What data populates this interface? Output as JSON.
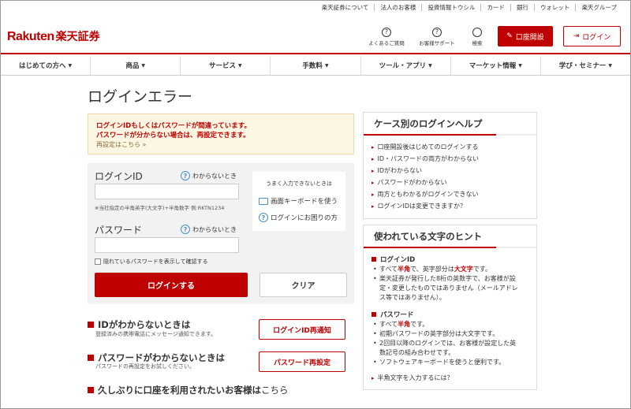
{
  "util_links": [
    "楽天証券について",
    "法人のお客様",
    "投資情報トウシル",
    "カード",
    "銀行",
    "ウォレット",
    "楽天グループ"
  ],
  "header": {
    "logo_text": "Rakuten",
    "logo_jp": "楽天証券",
    "faq_label": "よくあるご質問",
    "support_label": "お客様サポート",
    "search_label": "検索",
    "open_account_label": "口座開設",
    "login_label": "ログイン"
  },
  "nav": [
    "はじめての方へ",
    "商品",
    "サービス",
    "手数料",
    "ツール・アプリ",
    "マーケット情報",
    "学び・セミナー"
  ],
  "page_title": "ログインエラー",
  "error": {
    "line1": "ログインIDもしくはパスワードが間違っています。",
    "line2": "パスワードが分からない場合は、再設定できます。",
    "link": "再設定はこちら »"
  },
  "form": {
    "id_label": "ログインID",
    "id_help": "わからないとき",
    "id_hint": "※当社指定の半角英字(大文字)+半角数字 例:RKTN1234",
    "pw_label": "パスワード",
    "pw_help": "わからないとき",
    "side_title": "うまく入力できないときは",
    "side_kbd": "画面キーボードを使う",
    "side_help": "ログインにお困りの方",
    "show_pw": "隠れているパスワードを表示して確認する",
    "login_btn": "ログインする",
    "clear_btn": "クリア"
  },
  "help_rows": {
    "id_title": "IDがわからないとき は",
    "id_title_text": "IDがわからないときは",
    "id_sub": "登録済みの携帯電話にメッセージ通知できます。",
    "id_btn": "ログインID再通知",
    "pw_title": "パスワードがわからないときは",
    "pw_sub": "パスワードの再設定をお試しください。",
    "pw_btn": "パスワード再設定",
    "long_title": "久しぶりに口座を利用されたいお客様は",
    "long_link": "こちら"
  },
  "case_help": {
    "title": "ケース別のログインヘルプ",
    "items": [
      "口座開設後はじめてのログインする",
      "ID・パスワードの両方がわからない",
      "IDがわからない",
      "パスワードがわからない",
      "両方ともわかるがログインできない",
      "ログインIDは変更できますか？"
    ]
  },
  "char_hint": {
    "title": "使われている文字のヒント",
    "id_head": "ログインID",
    "id_b1_pre": "すべて",
    "id_b1_red1": "半角",
    "id_b1_mid": "で、英字部分は",
    "id_b1_red2": "大文字",
    "id_b1_post": "です。",
    "id_b2a": "楽天証券が発行した8桁の英数字で、お客様が設",
    "id_b2b": "定・変更したものではありません（メールアドレ",
    "id_b2c": "ス等ではありません）。",
    "pw_head": "パスワード",
    "pw_b1_pre": "すべて",
    "pw_b1_red": "半角",
    "pw_b1_post": "です。",
    "pw_b2": "初期パスワードの英字部分は大文字です。",
    "pw_b3a": "2回目以降のログインでは、お客様が設定した英",
    "pw_b3b": "数記号の組み合わせです。",
    "pw_b4": "ソフトウェアキーボードを使うと便利です。",
    "footer_link": "半角文字を入力するには？"
  }
}
